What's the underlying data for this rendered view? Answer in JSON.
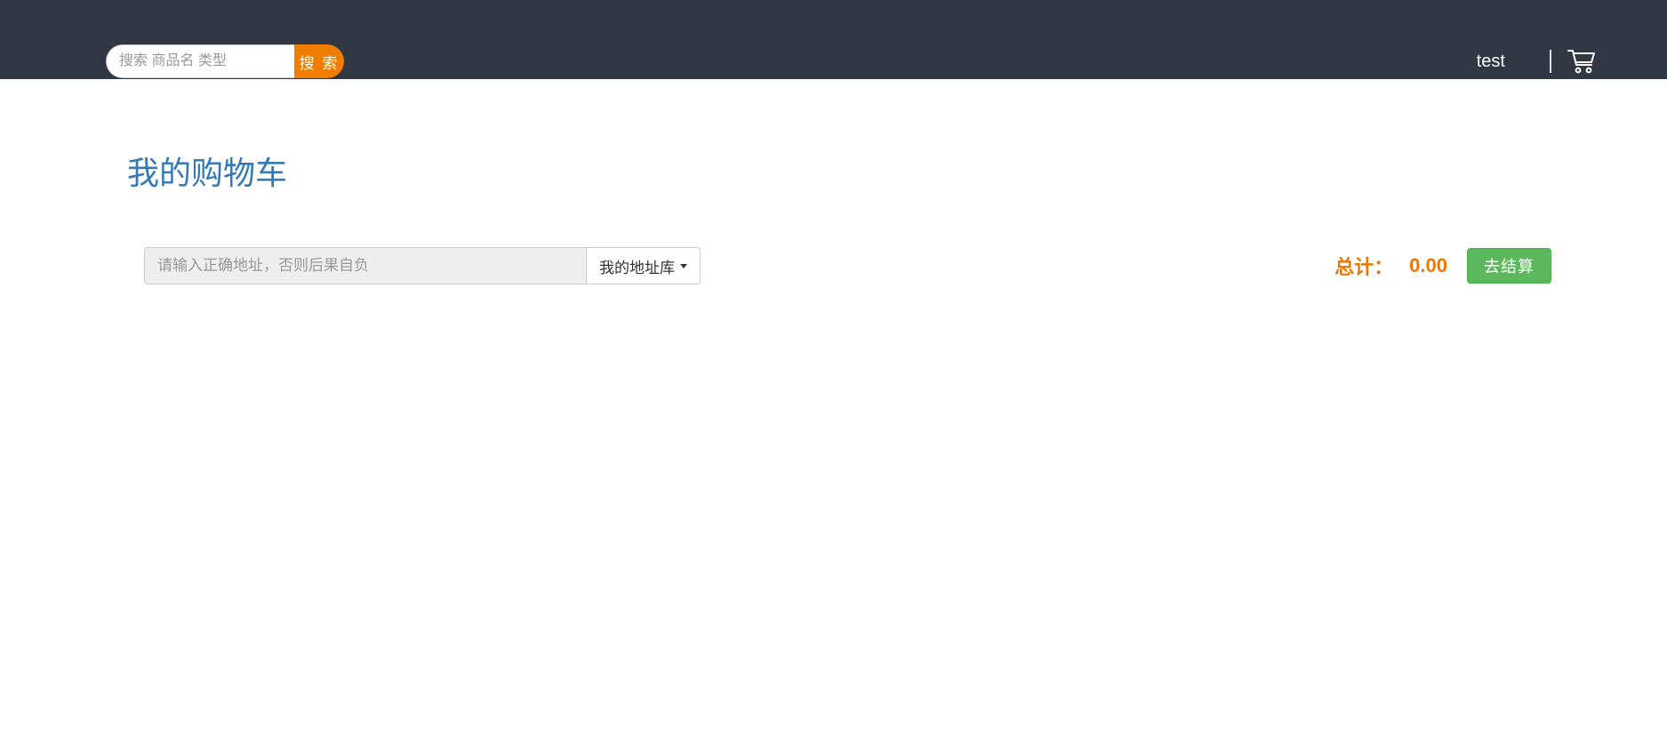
{
  "header": {
    "search_placeholder": "搜索 商品名 类型",
    "search_button": "搜 索",
    "username": "test"
  },
  "page": {
    "title": "我的购物车"
  },
  "address": {
    "input_placeholder": "请输入正确地址，否则后果自负",
    "dropdown_label": "我的地址库"
  },
  "summary": {
    "total_label": "总计：",
    "total_value": "0.00",
    "checkout_button": "去结算"
  }
}
